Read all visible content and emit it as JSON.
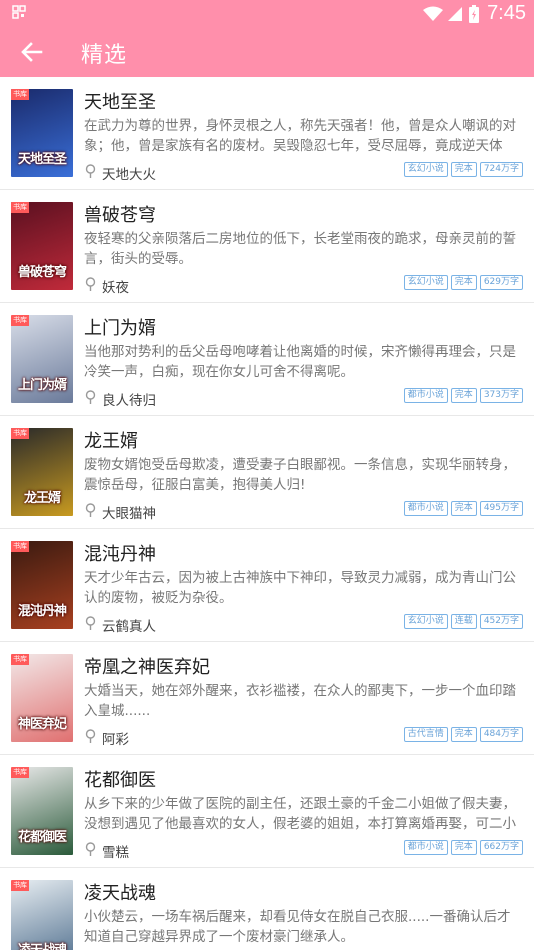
{
  "status_bar": {
    "time": "7:45"
  },
  "header": {
    "title": "精选"
  },
  "books": [
    {
      "title": "天地至圣",
      "desc": "在武力为尊的世界，身怀灵根之人，称先天强者！他，曾是众人嘲讽的对象；他，曾是家族有名的废材。吴毁隐忍七年，受尽屈辱，竟成逆天体",
      "author": "天地大火",
      "tags": [
        "玄幻小说",
        "完本",
        "724万字"
      ],
      "cover_text": "天地至圣",
      "cover_colors": [
        "#1a2a6b",
        "#3a6fd8"
      ]
    },
    {
      "title": "兽破苍穹",
      "desc": "夜轻寒的父亲陨落后二房地位的低下，长老堂雨夜的跪求，母亲灵前的誓言，街头的受辱。",
      "author": "妖夜",
      "tags": [
        "玄幻小说",
        "完本",
        "629万字"
      ],
      "cover_text": "兽破苍穹",
      "cover_colors": [
        "#5a1020",
        "#c02a3a"
      ]
    },
    {
      "title": "上门为婿",
      "desc": "当他那对势利的岳父岳母咆哮着让他离婚的时候，宋齐懒得再理会，只是冷笑一声，白痴，现在你女儿可舍不得离呢。",
      "author": "良人待归",
      "tags": [
        "都市小说",
        "完本",
        "373万字"
      ],
      "cover_text": "上门为婿",
      "cover_colors": [
        "#d8dde8",
        "#6a7a9a"
      ]
    },
    {
      "title": "龙王婿",
      "desc": "废物女婿饱受岳母欺凌，遭受妻子白眼鄙视。一条信息，实现华丽转身，震惊岳母，征服白富美，抱得美人归!",
      "author": "大眼猫神",
      "tags": [
        "都市小说",
        "完本",
        "495万字"
      ],
      "cover_text": "龙王婿",
      "cover_colors": [
        "#2a2a2a",
        "#c89a20"
      ]
    },
    {
      "title": "混沌丹神",
      "desc": "天才少年古云，因为被上古神族中下神印，导致灵力减弱，成为青山门公认的废物，被贬为杂役。",
      "author": "云鹤真人",
      "tags": [
        "玄幻小说",
        "连载",
        "452万字"
      ],
      "cover_text": "混沌丹神",
      "cover_colors": [
        "#3a1a10",
        "#a84020"
      ]
    },
    {
      "title": "帝凰之神医弃妃",
      "desc": "大婚当天，她在郊外醒来，衣衫褴褛，在众人的鄙夷下，一步一个血印踏入皇城......",
      "author": "阿彩",
      "tags": [
        "古代言情",
        "完本",
        "484万字"
      ],
      "cover_text": "神医弃妃",
      "cover_colors": [
        "#f2e8e8",
        "#e07070"
      ]
    },
    {
      "title": "花都御医",
      "desc": "从乡下来的少年做了医院的副主任，还跟土豪的千金二小姐做了假夫妻，没想到遇见了他最喜欢的女人，假老婆的姐姐，本打算离婚再娶，可二小",
      "author": "雪糕",
      "tags": [
        "都市小说",
        "完本",
        "662万字"
      ],
      "cover_text": "花都御医",
      "cover_colors": [
        "#e8e8e8",
        "#2a5a3a"
      ]
    },
    {
      "title": "凌天战魂",
      "desc": "小伙楚云，一场车祸后醒来，却看见侍女在脱自己衣服.....一番确认后才知道自己穿越异界成了一个废材豪门继承人。",
      "author": "",
      "tags": [],
      "cover_text": "凌天战魂",
      "cover_colors": [
        "#e8eef2",
        "#4a6a8a"
      ]
    }
  ]
}
